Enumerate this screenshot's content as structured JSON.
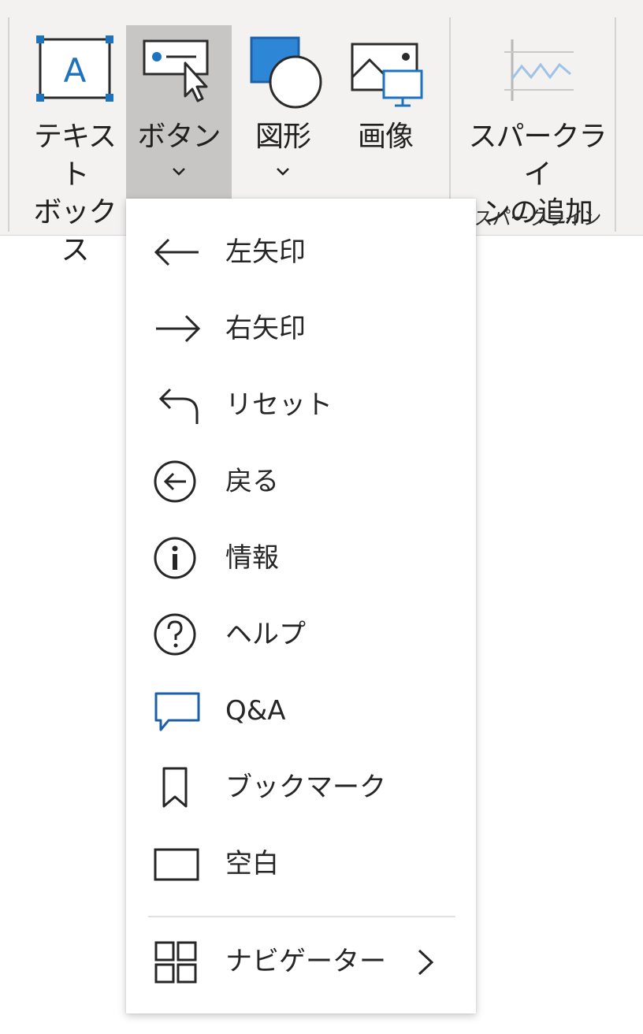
{
  "ribbon": {
    "text_box_label": "テキスト\nボックス",
    "button_label": "ボタン",
    "shapes_label": "図形",
    "image_label": "画像",
    "sparkline_label": "スパークライ\nンの追加",
    "sparkline_group_label": "スパークライン"
  },
  "menu": {
    "items": [
      {
        "label": "左矢印",
        "icon": "left-arrow-icon"
      },
      {
        "label": "右矢印",
        "icon": "right-arrow-icon"
      },
      {
        "label": "リセット",
        "icon": "reset-icon"
      },
      {
        "label": "戻る",
        "icon": "back-circle-icon"
      },
      {
        "label": "情報",
        "icon": "info-icon"
      },
      {
        "label": "ヘルプ",
        "icon": "help-icon"
      },
      {
        "label": "Q&A",
        "icon": "speech-bubble-icon"
      },
      {
        "label": "ブックマーク",
        "icon": "bookmark-icon"
      },
      {
        "label": "空白",
        "icon": "blank-rect-icon"
      }
    ],
    "navigator_label": "ナビゲーター"
  },
  "colors": {
    "accent_blue": "#1e73be",
    "icon_dark": "#262626",
    "active_button_bg": "#c8c6c4"
  }
}
